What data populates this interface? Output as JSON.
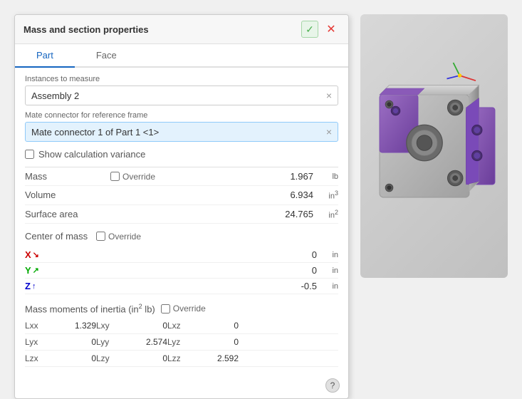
{
  "dialog": {
    "title": "Mass and section properties",
    "check_label": "✓",
    "close_label": "✕",
    "tabs": [
      {
        "id": "part",
        "label": "Part",
        "active": true
      },
      {
        "id": "face",
        "label": "Face",
        "active": false
      }
    ],
    "instances_label": "Instances to measure",
    "instances_value": "Assembly 2",
    "mate_connector_label": "Mate connector for reference frame",
    "mate_connector_value": "Mate connector 1 of Part 1 <1>",
    "show_calculation_variance": "Show calculation variance",
    "mass_label": "Mass",
    "mass_override": "Override",
    "mass_value": "1.967",
    "mass_unit": "lb",
    "volume_label": "Volume",
    "volume_value": "6.934",
    "volume_unit": "in³",
    "surface_area_label": "Surface area",
    "surface_area_value": "24.765",
    "surface_area_unit": "in²",
    "center_of_mass_label": "Center of mass",
    "center_of_mass_override": "Override",
    "axis_x_label": "X",
    "axis_x_arrow": "↘",
    "axis_x_value": "0",
    "axis_x_unit": "in",
    "axis_y_label": "Y",
    "axis_y_arrow": "↗",
    "axis_y_value": "0",
    "axis_y_unit": "in",
    "axis_z_label": "Z",
    "axis_z_arrow": "↑",
    "axis_z_value": "-0.5",
    "axis_z_unit": "in",
    "inertia_label": "Mass moments of inertia (in² lb)",
    "inertia_override": "Override",
    "inertia_rows": [
      {
        "col1_label": "Lxx",
        "col1_value": "1.329",
        "col2_label": "Lxy",
        "col2_value": "0",
        "col3_label": "Lxz",
        "col3_value": "0"
      },
      {
        "col1_label": "Lyx",
        "col1_value": "0",
        "col2_label": "Lyy",
        "col2_value": "2.574",
        "col3_label": "Lyz",
        "col3_value": "0"
      },
      {
        "col1_label": "Lzx",
        "col1_value": "0",
        "col2_label": "Lzy",
        "col2_value": "0",
        "col3_label": "Lzz",
        "col3_value": "2.592"
      }
    ],
    "help_label": "?"
  }
}
